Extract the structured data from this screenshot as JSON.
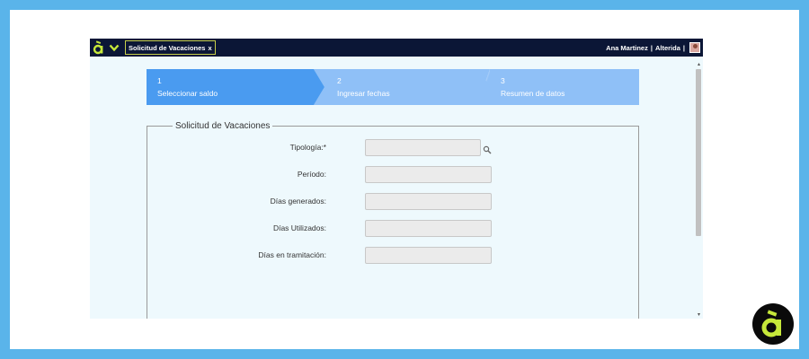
{
  "colors": {
    "outer_frame": "#5ab4ea",
    "topbar": "#0b1636",
    "step_active": "#4a9bf0",
    "step_inactive": "#8fc0f7",
    "brand_lime": "#c6e83a",
    "app_background": "#eef9fd"
  },
  "topbar": {
    "logo_icon": "brand-a-icon",
    "menu_icon": "chevron-down-icon",
    "tab": {
      "label": "Solicitud de Vacaciones",
      "close": "x"
    },
    "user": {
      "name": "Ana Martinez",
      "separator": "|",
      "company": "Alterida",
      "separator2": "|",
      "avatar_icon": "avatar-icon"
    }
  },
  "steps": [
    {
      "number": "1",
      "label": "Seleccionar saldo",
      "active": true
    },
    {
      "number": "2",
      "label": "Ingresar fechas",
      "active": false
    },
    {
      "number": "3",
      "label": "Resumen de datos",
      "active": false
    }
  ],
  "form": {
    "legend": "Solicitud de Vacaciones",
    "fields": [
      {
        "label": "Tipología:*",
        "value": "",
        "lookup_icon": "search-icon"
      },
      {
        "label": "Período:",
        "value": ""
      },
      {
        "label": "Días generados:",
        "value": ""
      },
      {
        "label": "Días Utilizados:",
        "value": ""
      },
      {
        "label": "Días en tramitación:",
        "value": ""
      }
    ]
  },
  "scrollbar": {
    "up": "▴",
    "down": "▾"
  },
  "brand_badge_icon": "brand-a-icon"
}
